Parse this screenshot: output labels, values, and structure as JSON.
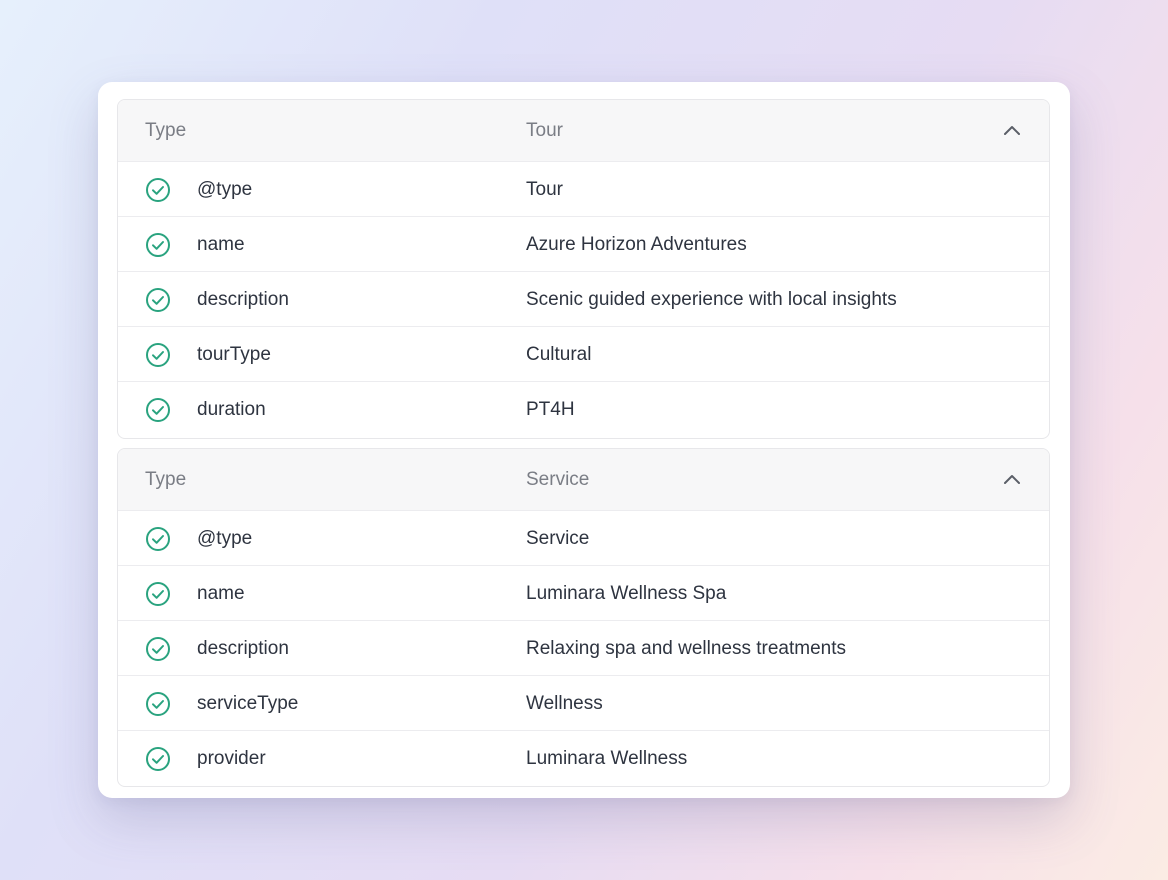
{
  "sections": [
    {
      "header": {
        "key_label": "Type",
        "value_label": "Tour"
      },
      "rows": [
        {
          "key": "@type",
          "value": "Tour"
        },
        {
          "key": "name",
          "value": "Azure Horizon Adventures"
        },
        {
          "key": "description",
          "value": "Scenic guided experience with local insights"
        },
        {
          "key": "tourType",
          "value": "Cultural"
        },
        {
          "key": "duration",
          "value": "PT4H"
        }
      ]
    },
    {
      "header": {
        "key_label": "Type",
        "value_label": "Service"
      },
      "rows": [
        {
          "key": "@type",
          "value": "Service"
        },
        {
          "key": "name",
          "value": "Luminara Wellness Spa"
        },
        {
          "key": "description",
          "value": "Relaxing spa and wellness treatments"
        },
        {
          "key": "serviceType",
          "value": "Wellness"
        },
        {
          "key": "provider",
          "value": "Luminara Wellness"
        }
      ]
    }
  ],
  "icons": {
    "row_status": "check-circle-icon",
    "collapse": "chevron-up-icon"
  },
  "colors": {
    "check": "#2aa37f",
    "header_bg": "#f7f7f8"
  }
}
